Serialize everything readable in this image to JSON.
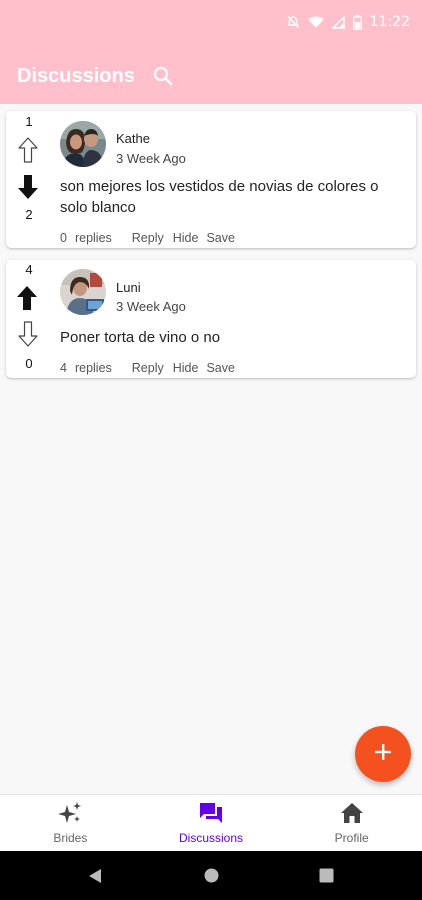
{
  "status_bar": {
    "time": "11:22",
    "icons": [
      "mute-icon",
      "wifi-icon",
      "signal-icon",
      "battery-icon"
    ]
  },
  "app_bar": {
    "title": "Discussions",
    "search_icon": "search-icon"
  },
  "discussions": [
    {
      "upvotes": "1",
      "downvotes": "2",
      "upvote_state": "outline",
      "downvote_state": "filled",
      "author": "Kathe",
      "time_ago": "3 Week Ago",
      "text": "son mejores los vestidos de novias de colores o solo blanco",
      "replies_count": "0",
      "replies_label": "replies",
      "reply_label": "Reply",
      "hide_label": "Hide",
      "save_label": "Save"
    },
    {
      "upvotes": "4",
      "downvotes": "0",
      "upvote_state": "filled",
      "downvote_state": "outline",
      "author": "Luni",
      "time_ago": "3 Week Ago",
      "text": "Poner torta de vino o no",
      "replies_count": "4",
      "replies_label": "replies",
      "reply_label": "Reply",
      "hide_label": "Hide",
      "save_label": "Save"
    }
  ],
  "fab": {
    "icon": "plus-icon",
    "color": "#f4511e"
  },
  "bottom_nav": {
    "items": [
      {
        "label": "Brides",
        "icon": "sparkle-icon",
        "active": false
      },
      {
        "label": "Discussions",
        "icon": "forum-icon",
        "active": true
      },
      {
        "label": "Profile",
        "icon": "home-icon",
        "active": false
      }
    ],
    "active_color": "#6200ee"
  },
  "theme": {
    "header_color": "#ffc0cb",
    "accent": "#f4511e"
  },
  "system_nav": {
    "icons": [
      "back-icon",
      "home-circle-icon",
      "recents-icon"
    ]
  }
}
